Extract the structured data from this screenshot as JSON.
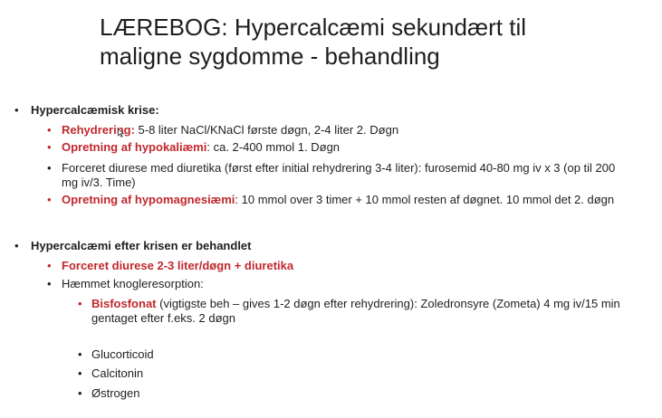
{
  "slide": {
    "title_line1": "LÆREBOG: Hypercalcæmi sekundært til",
    "title_line2": "maligne sygdomme - behandling"
  },
  "bullets": {
    "l1_bullet": "•",
    "l2_bullet": "•",
    "section1": {
      "heading": "Hypercalcæmisk krise:",
      "rehydrering_label": "Rehydrering:",
      "rehydrering_text": " 5-8 liter NaCl/KNaCl første døgn, 2-4 liter 2. Døgn",
      "hypokal_label": "Opretning af hypokaliæmi",
      "hypokal_text": ": ca. 2-400 mmol 1. Døgn",
      "diurese_line1": "Forceret diurese med diuretika (først efter initial rehydrering 3-4 liter): furosemid 40-80 mg iv x 3 (op til 200",
      "diurese_line2": "mg iv/3. Time)",
      "hypomag_label": "Opretning af hypomagnesiæmi",
      "hypomag_text": ": 10 mmol over 3 timer + 10 mmol resten af døgnet. 10 mmol det 2. døgn"
    },
    "section2": {
      "heading": "Hypercalcæmi efter krisen er behandlet",
      "forceret": "Forceret diurese 2-3 liter/døgn + diuretika",
      "haemmet": "Hæmmet knogleresorption:",
      "bisfos_label": "Bisfosfonat",
      "bisfos_text_line1": " (vigtigste beh – gives 1-2 døgn efter rehydrering): Zoledronsyre (Zometa) 4 mg iv/15 min",
      "bisfos_text_line2": "gentaget efter f.eks. 2 døgn",
      "glucocorticoid": "Glucorticoid",
      "calcitonin": "Calcitonin",
      "oestrogen": "Østrogen"
    }
  },
  "icons": {
    "cursor": "mouse-pointer-icon"
  },
  "colors": {
    "accent_red": "#c0282d",
    "text": "#1f1f1f",
    "background": "#ffffff"
  }
}
